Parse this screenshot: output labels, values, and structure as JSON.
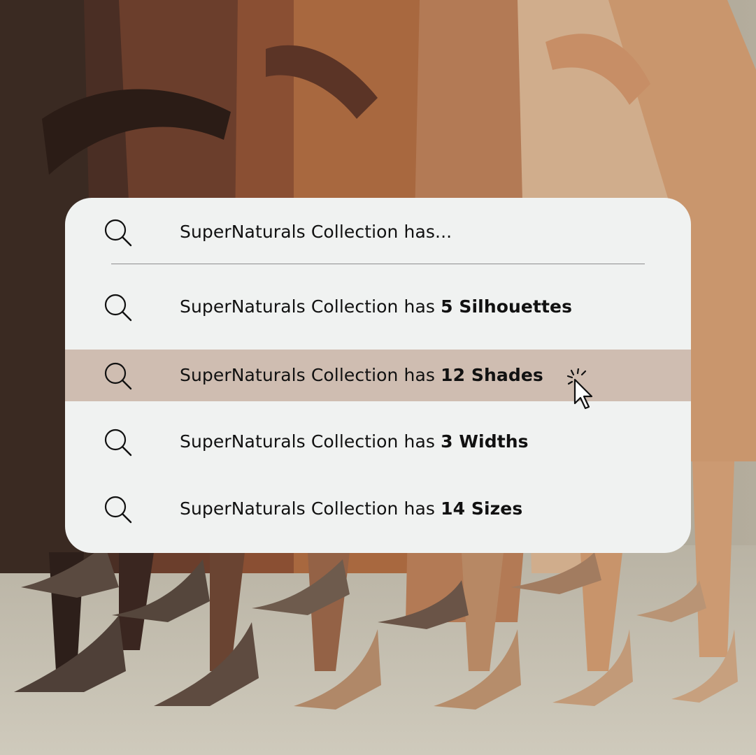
{
  "search": {
    "query": {
      "text": "SuperNaturals Collection has..."
    },
    "suggestions": [
      {
        "prefix": "SuperNaturals Collection has ",
        "highlight": "5 Silhouettes"
      },
      {
        "prefix": "SuperNaturals Collection has ",
        "highlight": "12 Shades",
        "hovered": true
      },
      {
        "prefix": "SuperNaturals Collection has ",
        "highlight": "3 Widths"
      },
      {
        "prefix": "SuperNaturals Collection has ",
        "highlight": "14 Sizes"
      }
    ],
    "icon": "search-icon"
  },
  "colors": {
    "panel_bg": "#f0f2f1",
    "highlight_row": "#cfbdb1",
    "text": "#111111"
  },
  "cursor_icon": "pointer-cursor-icon"
}
